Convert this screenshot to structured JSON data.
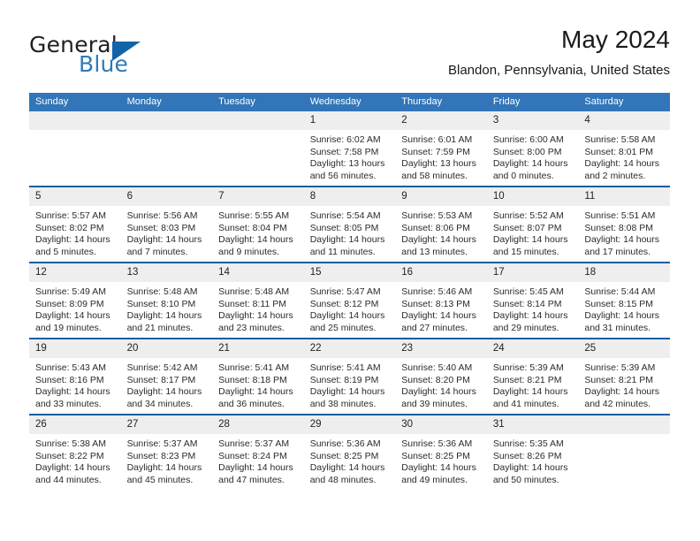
{
  "brand": {
    "name_top": "General",
    "name_bottom": "Blue",
    "triangle_icon": "triangle-icon",
    "colors": {
      "dark": "#231f20",
      "blue": "#2e7ab8",
      "triangle": "#1263a8"
    }
  },
  "header": {
    "title": "May 2024",
    "subtitle": "Blandon, Pennsylvania, United States"
  },
  "theme": {
    "header_blue": "#3275b8",
    "separator_blue": "#1c5d9e",
    "daynum_gray": "#eeeeee"
  },
  "columns": [
    "Sunday",
    "Monday",
    "Tuesday",
    "Wednesday",
    "Thursday",
    "Friday",
    "Saturday"
  ],
  "weeks": [
    [
      {
        "day": ""
      },
      {
        "day": ""
      },
      {
        "day": ""
      },
      {
        "day": "1",
        "sunrise": "Sunrise: 6:02 AM",
        "sunset": "Sunset: 7:58 PM",
        "daylight": "Daylight: 13 hours and 56 minutes."
      },
      {
        "day": "2",
        "sunrise": "Sunrise: 6:01 AM",
        "sunset": "Sunset: 7:59 PM",
        "daylight": "Daylight: 13 hours and 58 minutes."
      },
      {
        "day": "3",
        "sunrise": "Sunrise: 6:00 AM",
        "sunset": "Sunset: 8:00 PM",
        "daylight": "Daylight: 14 hours and 0 minutes."
      },
      {
        "day": "4",
        "sunrise": "Sunrise: 5:58 AM",
        "sunset": "Sunset: 8:01 PM",
        "daylight": "Daylight: 14 hours and 2 minutes."
      }
    ],
    [
      {
        "day": "5",
        "sunrise": "Sunrise: 5:57 AM",
        "sunset": "Sunset: 8:02 PM",
        "daylight": "Daylight: 14 hours and 5 minutes."
      },
      {
        "day": "6",
        "sunrise": "Sunrise: 5:56 AM",
        "sunset": "Sunset: 8:03 PM",
        "daylight": "Daylight: 14 hours and 7 minutes."
      },
      {
        "day": "7",
        "sunrise": "Sunrise: 5:55 AM",
        "sunset": "Sunset: 8:04 PM",
        "daylight": "Daylight: 14 hours and 9 minutes."
      },
      {
        "day": "8",
        "sunrise": "Sunrise: 5:54 AM",
        "sunset": "Sunset: 8:05 PM",
        "daylight": "Daylight: 14 hours and 11 minutes."
      },
      {
        "day": "9",
        "sunrise": "Sunrise: 5:53 AM",
        "sunset": "Sunset: 8:06 PM",
        "daylight": "Daylight: 14 hours and 13 minutes."
      },
      {
        "day": "10",
        "sunrise": "Sunrise: 5:52 AM",
        "sunset": "Sunset: 8:07 PM",
        "daylight": "Daylight: 14 hours and 15 minutes."
      },
      {
        "day": "11",
        "sunrise": "Sunrise: 5:51 AM",
        "sunset": "Sunset: 8:08 PM",
        "daylight": "Daylight: 14 hours and 17 minutes."
      }
    ],
    [
      {
        "day": "12",
        "sunrise": "Sunrise: 5:49 AM",
        "sunset": "Sunset: 8:09 PM",
        "daylight": "Daylight: 14 hours and 19 minutes."
      },
      {
        "day": "13",
        "sunrise": "Sunrise: 5:48 AM",
        "sunset": "Sunset: 8:10 PM",
        "daylight": "Daylight: 14 hours and 21 minutes."
      },
      {
        "day": "14",
        "sunrise": "Sunrise: 5:48 AM",
        "sunset": "Sunset: 8:11 PM",
        "daylight": "Daylight: 14 hours and 23 minutes."
      },
      {
        "day": "15",
        "sunrise": "Sunrise: 5:47 AM",
        "sunset": "Sunset: 8:12 PM",
        "daylight": "Daylight: 14 hours and 25 minutes."
      },
      {
        "day": "16",
        "sunrise": "Sunrise: 5:46 AM",
        "sunset": "Sunset: 8:13 PM",
        "daylight": "Daylight: 14 hours and 27 minutes."
      },
      {
        "day": "17",
        "sunrise": "Sunrise: 5:45 AM",
        "sunset": "Sunset: 8:14 PM",
        "daylight": "Daylight: 14 hours and 29 minutes."
      },
      {
        "day": "18",
        "sunrise": "Sunrise: 5:44 AM",
        "sunset": "Sunset: 8:15 PM",
        "daylight": "Daylight: 14 hours and 31 minutes."
      }
    ],
    [
      {
        "day": "19",
        "sunrise": "Sunrise: 5:43 AM",
        "sunset": "Sunset: 8:16 PM",
        "daylight": "Daylight: 14 hours and 33 minutes."
      },
      {
        "day": "20",
        "sunrise": "Sunrise: 5:42 AM",
        "sunset": "Sunset: 8:17 PM",
        "daylight": "Daylight: 14 hours and 34 minutes."
      },
      {
        "day": "21",
        "sunrise": "Sunrise: 5:41 AM",
        "sunset": "Sunset: 8:18 PM",
        "daylight": "Daylight: 14 hours and 36 minutes."
      },
      {
        "day": "22",
        "sunrise": "Sunrise: 5:41 AM",
        "sunset": "Sunset: 8:19 PM",
        "daylight": "Daylight: 14 hours and 38 minutes."
      },
      {
        "day": "23",
        "sunrise": "Sunrise: 5:40 AM",
        "sunset": "Sunset: 8:20 PM",
        "daylight": "Daylight: 14 hours and 39 minutes."
      },
      {
        "day": "24",
        "sunrise": "Sunrise: 5:39 AM",
        "sunset": "Sunset: 8:21 PM",
        "daylight": "Daylight: 14 hours and 41 minutes."
      },
      {
        "day": "25",
        "sunrise": "Sunrise: 5:39 AM",
        "sunset": "Sunset: 8:21 PM",
        "daylight": "Daylight: 14 hours and 42 minutes."
      }
    ],
    [
      {
        "day": "26",
        "sunrise": "Sunrise: 5:38 AM",
        "sunset": "Sunset: 8:22 PM",
        "daylight": "Daylight: 14 hours and 44 minutes."
      },
      {
        "day": "27",
        "sunrise": "Sunrise: 5:37 AM",
        "sunset": "Sunset: 8:23 PM",
        "daylight": "Daylight: 14 hours and 45 minutes."
      },
      {
        "day": "28",
        "sunrise": "Sunrise: 5:37 AM",
        "sunset": "Sunset: 8:24 PM",
        "daylight": "Daylight: 14 hours and 47 minutes."
      },
      {
        "day": "29",
        "sunrise": "Sunrise: 5:36 AM",
        "sunset": "Sunset: 8:25 PM",
        "daylight": "Daylight: 14 hours and 48 minutes."
      },
      {
        "day": "30",
        "sunrise": "Sunrise: 5:36 AM",
        "sunset": "Sunset: 8:25 PM",
        "daylight": "Daylight: 14 hours and 49 minutes."
      },
      {
        "day": "31",
        "sunrise": "Sunrise: 5:35 AM",
        "sunset": "Sunset: 8:26 PM",
        "daylight": "Daylight: 14 hours and 50 minutes."
      },
      {
        "day": ""
      }
    ]
  ]
}
